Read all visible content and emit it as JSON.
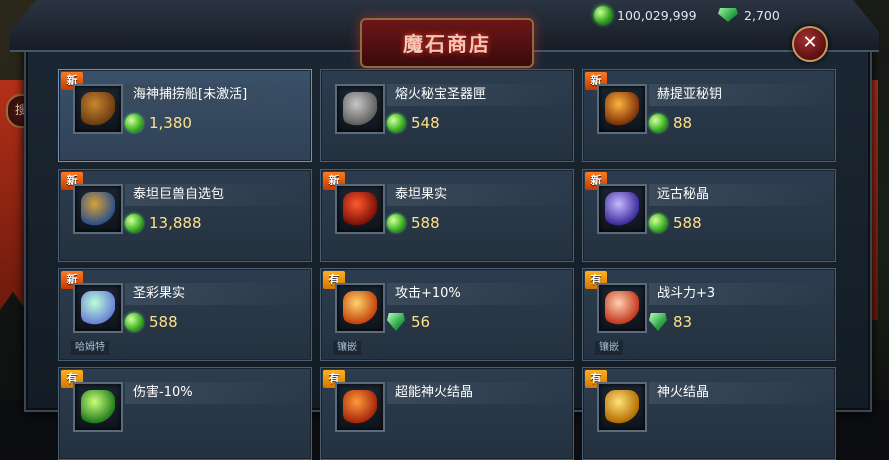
{
  "header": {
    "title": "魔石商店",
    "coins": "100,029,999",
    "gems": "2,700",
    "search_tab": "搜索"
  },
  "colors": {
    "price": "#ffe08a",
    "badge_new": "#ff7a1f",
    "badge_hot": "#ffb11f",
    "title_glow": "#ff3b20"
  },
  "items": [
    {
      "badge": "新",
      "name": "海神捕捞船[未激活]",
      "price": "1,380",
      "currency": "coin",
      "icon": "ship-icon",
      "tag": ""
    },
    {
      "badge": "",
      "name": "熔火秘宝圣器匣",
      "price": "548",
      "currency": "coin",
      "icon": "chest-icon",
      "tag": ""
    },
    {
      "badge": "新",
      "name": "赫提亚秘钥",
      "price": "88",
      "currency": "coin",
      "icon": "key-icon",
      "tag": ""
    },
    {
      "badge": "新",
      "name": "泰坦巨兽自选包",
      "price": "13,888",
      "currency": "coin",
      "icon": "gift-box-icon",
      "tag": ""
    },
    {
      "badge": "新",
      "name": "泰坦果实",
      "price": "588",
      "currency": "coin",
      "icon": "fruit-icon",
      "tag": ""
    },
    {
      "badge": "新",
      "name": "远古秘晶",
      "price": "588",
      "currency": "coin",
      "icon": "crystal-icon",
      "tag": ""
    },
    {
      "badge": "新",
      "name": "圣彩果实",
      "price": "588",
      "currency": "coin",
      "icon": "rainbow-fruit-icon",
      "tag": "哈姆特"
    },
    {
      "badge": "有",
      "name": "攻击+10%",
      "price": "56",
      "currency": "gem",
      "icon": "flame-rune-icon",
      "tag": "镶嵌"
    },
    {
      "badge": "有",
      "name": "战斗力+3",
      "price": "83",
      "currency": "gem",
      "icon": "red-rune-icon",
      "tag": "镶嵌"
    },
    {
      "badge": "有",
      "name": "伤害-10%",
      "price": "",
      "currency": "coin",
      "icon": "green-gem-icon",
      "tag": ""
    },
    {
      "badge": "有",
      "name": "超能神火结晶",
      "price": "",
      "currency": "coin",
      "icon": "fire-crystal-icon",
      "tag": ""
    },
    {
      "badge": "有",
      "name": "神火结晶",
      "price": "",
      "currency": "coin",
      "icon": "gold-crystal-icon",
      "tag": ""
    }
  ]
}
